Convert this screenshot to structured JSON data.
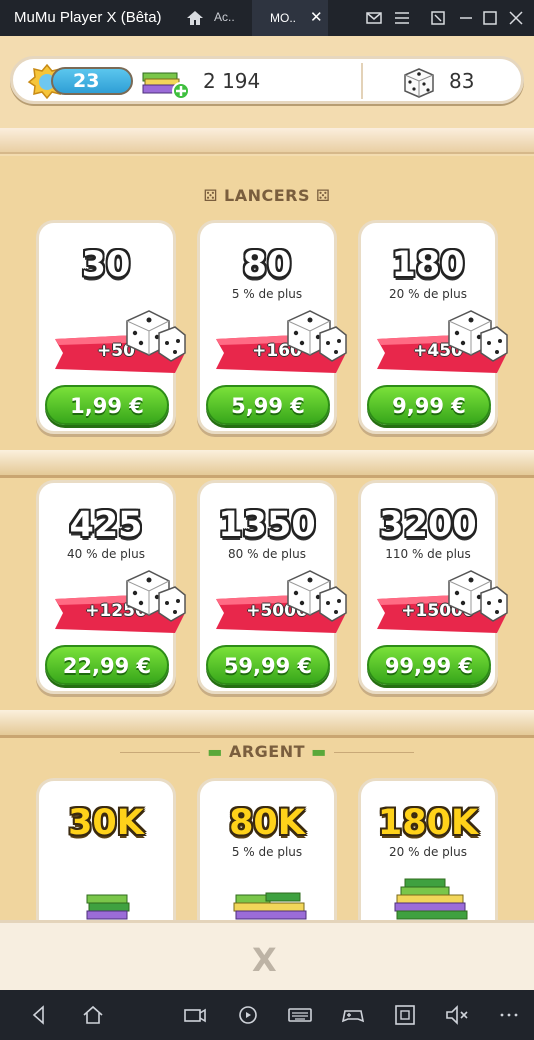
{
  "window": {
    "title": "MuMu Player X  (Bêta)",
    "tabs": [
      {
        "label": "Ac.."
      },
      {
        "label": "MO.."
      }
    ]
  },
  "topbar": {
    "level": "23",
    "money": "2 194",
    "dice": "83"
  },
  "sections": {
    "dice_title": "LANCERS",
    "money_title": "ARGENT"
  },
  "dice_offers": [
    {
      "amount": "30",
      "subtitle": "",
      "bonus": "+50",
      "price": "1,99 €"
    },
    {
      "amount": "80",
      "subtitle": "5 % de plus",
      "bonus": "+160",
      "price": "5,99 €"
    },
    {
      "amount": "180",
      "subtitle": "20 % de plus",
      "bonus": "+450",
      "price": "9,99 €"
    },
    {
      "amount": "425",
      "subtitle": "40 % de plus",
      "bonus": "+1250",
      "price": "22,99 €"
    },
    {
      "amount": "1350",
      "subtitle": "80 % de plus",
      "bonus": "+5000",
      "price": "59,99 €"
    },
    {
      "amount": "3200",
      "subtitle": "110 % de plus",
      "bonus": "+15000",
      "price": "99,99 €"
    }
  ],
  "money_offers": [
    {
      "amount": "30K",
      "subtitle": ""
    },
    {
      "amount": "80K",
      "subtitle": "5 % de plus"
    },
    {
      "amount": "180K",
      "subtitle": "20 % de plus"
    }
  ],
  "footer": {
    "close": "X"
  },
  "colors": {
    "price_green": "#4cc327",
    "ribbon_red": "#e8274b",
    "panel": "#f0d59e",
    "level_blue": "#3aa9df"
  },
  "icons": [
    "home-icon",
    "mail-icon",
    "menu-icon",
    "resize-icon",
    "minimize-icon",
    "maximize-icon",
    "close-icon",
    "back-icon",
    "home-nav-icon",
    "camera-icon",
    "gamepad-icon",
    "keyboard-icon",
    "controller-icon",
    "screen-icon",
    "mute-icon",
    "more-icon"
  ]
}
